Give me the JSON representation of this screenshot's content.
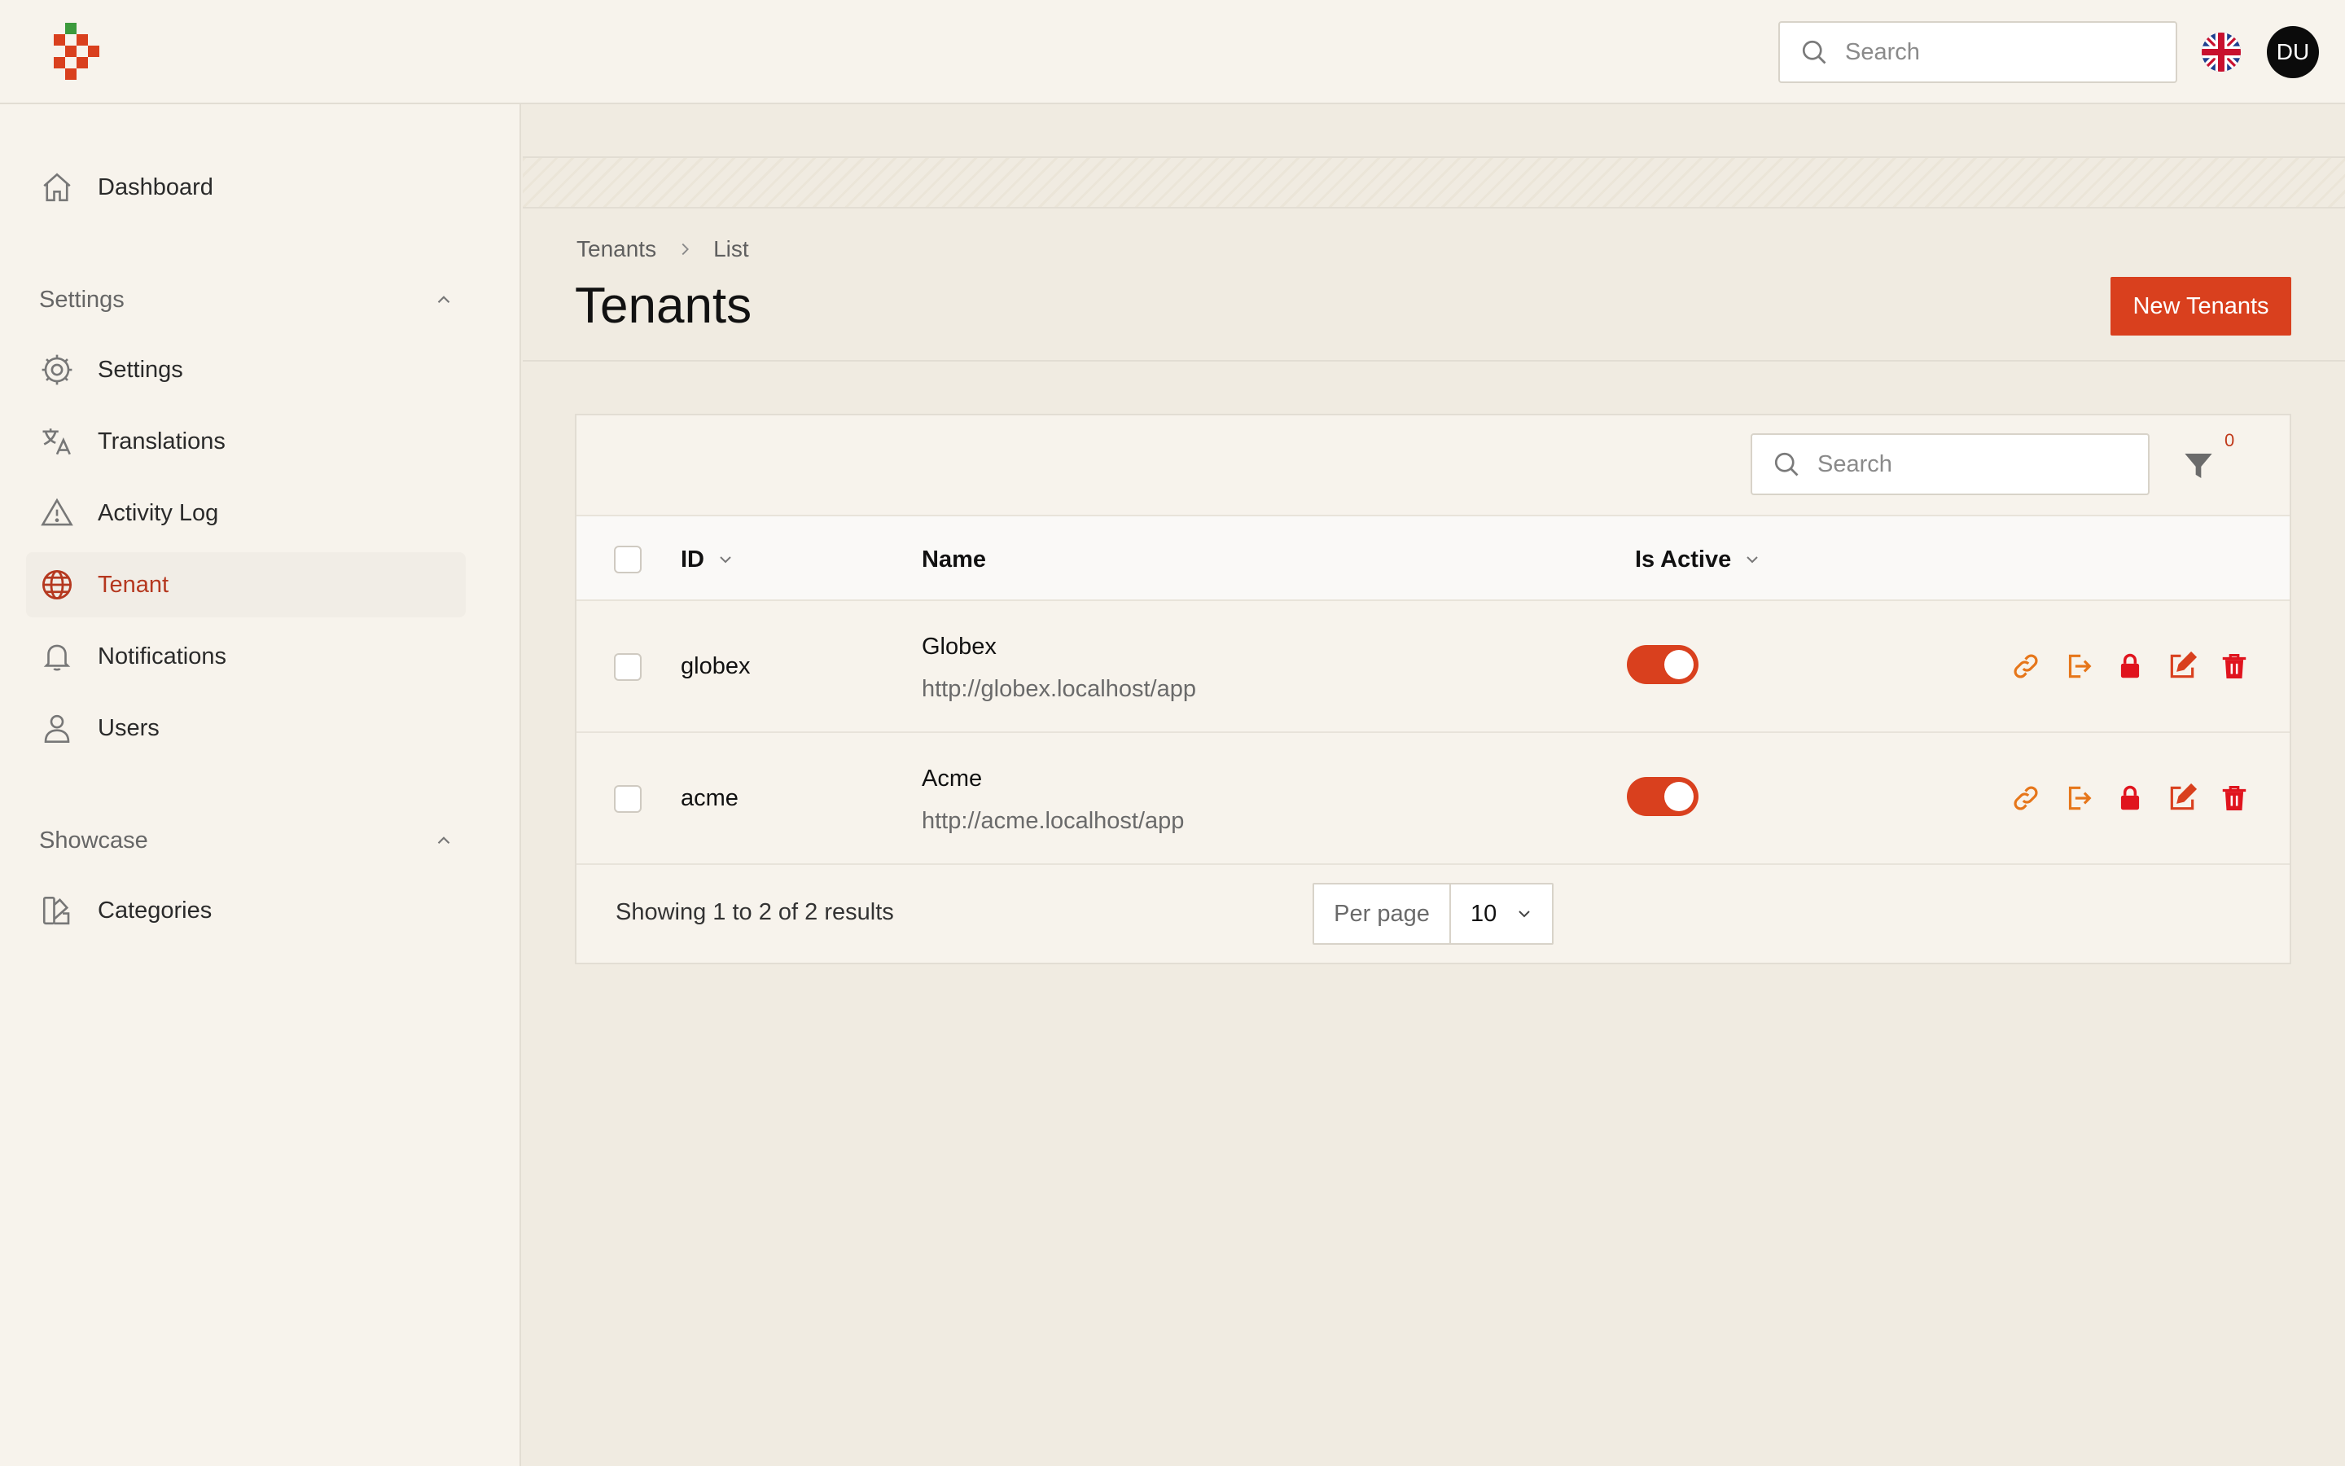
{
  "topbar": {
    "search_placeholder": "Search",
    "avatar_initials": "DU"
  },
  "sidebar": {
    "dashboard": "Dashboard",
    "settings_group": "Settings",
    "items": [
      "Settings",
      "Translations",
      "Activity Log",
      "Tenant",
      "Notifications",
      "Users"
    ],
    "showcase_group": "Showcase",
    "showcase_items": [
      "Categories"
    ]
  },
  "breadcrumb": [
    "Tenants",
    "List"
  ],
  "page": {
    "title": "Tenants",
    "new_button": "New Tenants"
  },
  "table": {
    "search_placeholder": "Search",
    "filter_count": "0",
    "columns": {
      "id": "ID",
      "name": "Name",
      "is_active": "Is Active"
    },
    "rows": [
      {
        "id": "globex",
        "name": "Globex",
        "url": "http://globex.localhost/app",
        "active": true
      },
      {
        "id": "acme",
        "name": "Acme",
        "url": "http://acme.localhost/app",
        "active": true
      }
    ],
    "showing": "Showing 1 to 2 of 2 results",
    "per_page_label": "Per page",
    "per_page_value": "10"
  },
  "colors": {
    "accent": "#d9401e",
    "danger": "#e0141e",
    "orange": "#e6761a"
  }
}
